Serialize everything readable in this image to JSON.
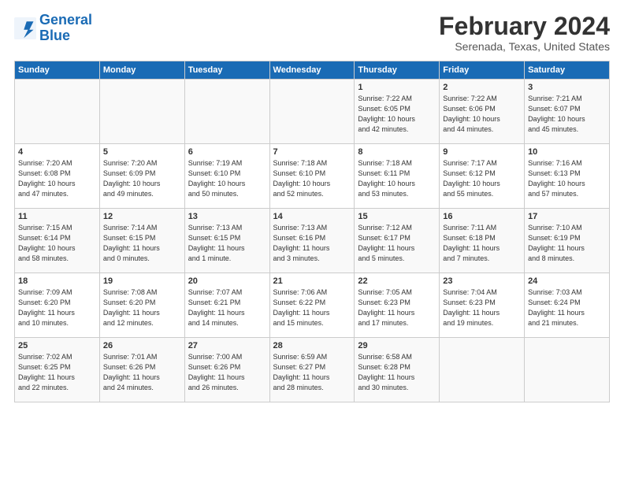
{
  "header": {
    "logo_line1": "General",
    "logo_line2": "Blue",
    "title": "February 2024",
    "subtitle": "Serenada, Texas, United States"
  },
  "weekdays": [
    "Sunday",
    "Monday",
    "Tuesday",
    "Wednesday",
    "Thursday",
    "Friday",
    "Saturday"
  ],
  "weeks": [
    [
      {
        "day": "",
        "info": ""
      },
      {
        "day": "",
        "info": ""
      },
      {
        "day": "",
        "info": ""
      },
      {
        "day": "",
        "info": ""
      },
      {
        "day": "1",
        "info": "Sunrise: 7:22 AM\nSunset: 6:05 PM\nDaylight: 10 hours\nand 42 minutes."
      },
      {
        "day": "2",
        "info": "Sunrise: 7:22 AM\nSunset: 6:06 PM\nDaylight: 10 hours\nand 44 minutes."
      },
      {
        "day": "3",
        "info": "Sunrise: 7:21 AM\nSunset: 6:07 PM\nDaylight: 10 hours\nand 45 minutes."
      }
    ],
    [
      {
        "day": "4",
        "info": "Sunrise: 7:20 AM\nSunset: 6:08 PM\nDaylight: 10 hours\nand 47 minutes."
      },
      {
        "day": "5",
        "info": "Sunrise: 7:20 AM\nSunset: 6:09 PM\nDaylight: 10 hours\nand 49 minutes."
      },
      {
        "day": "6",
        "info": "Sunrise: 7:19 AM\nSunset: 6:10 PM\nDaylight: 10 hours\nand 50 minutes."
      },
      {
        "day": "7",
        "info": "Sunrise: 7:18 AM\nSunset: 6:10 PM\nDaylight: 10 hours\nand 52 minutes."
      },
      {
        "day": "8",
        "info": "Sunrise: 7:18 AM\nSunset: 6:11 PM\nDaylight: 10 hours\nand 53 minutes."
      },
      {
        "day": "9",
        "info": "Sunrise: 7:17 AM\nSunset: 6:12 PM\nDaylight: 10 hours\nand 55 minutes."
      },
      {
        "day": "10",
        "info": "Sunrise: 7:16 AM\nSunset: 6:13 PM\nDaylight: 10 hours\nand 57 minutes."
      }
    ],
    [
      {
        "day": "11",
        "info": "Sunrise: 7:15 AM\nSunset: 6:14 PM\nDaylight: 10 hours\nand 58 minutes."
      },
      {
        "day": "12",
        "info": "Sunrise: 7:14 AM\nSunset: 6:15 PM\nDaylight: 11 hours\nand 0 minutes."
      },
      {
        "day": "13",
        "info": "Sunrise: 7:13 AM\nSunset: 6:15 PM\nDaylight: 11 hours\nand 1 minute."
      },
      {
        "day": "14",
        "info": "Sunrise: 7:13 AM\nSunset: 6:16 PM\nDaylight: 11 hours\nand 3 minutes."
      },
      {
        "day": "15",
        "info": "Sunrise: 7:12 AM\nSunset: 6:17 PM\nDaylight: 11 hours\nand 5 minutes."
      },
      {
        "day": "16",
        "info": "Sunrise: 7:11 AM\nSunset: 6:18 PM\nDaylight: 11 hours\nand 7 minutes."
      },
      {
        "day": "17",
        "info": "Sunrise: 7:10 AM\nSunset: 6:19 PM\nDaylight: 11 hours\nand 8 minutes."
      }
    ],
    [
      {
        "day": "18",
        "info": "Sunrise: 7:09 AM\nSunset: 6:20 PM\nDaylight: 11 hours\nand 10 minutes."
      },
      {
        "day": "19",
        "info": "Sunrise: 7:08 AM\nSunset: 6:20 PM\nDaylight: 11 hours\nand 12 minutes."
      },
      {
        "day": "20",
        "info": "Sunrise: 7:07 AM\nSunset: 6:21 PM\nDaylight: 11 hours\nand 14 minutes."
      },
      {
        "day": "21",
        "info": "Sunrise: 7:06 AM\nSunset: 6:22 PM\nDaylight: 11 hours\nand 15 minutes."
      },
      {
        "day": "22",
        "info": "Sunrise: 7:05 AM\nSunset: 6:23 PM\nDaylight: 11 hours\nand 17 minutes."
      },
      {
        "day": "23",
        "info": "Sunrise: 7:04 AM\nSunset: 6:23 PM\nDaylight: 11 hours\nand 19 minutes."
      },
      {
        "day": "24",
        "info": "Sunrise: 7:03 AM\nSunset: 6:24 PM\nDaylight: 11 hours\nand 21 minutes."
      }
    ],
    [
      {
        "day": "25",
        "info": "Sunrise: 7:02 AM\nSunset: 6:25 PM\nDaylight: 11 hours\nand 22 minutes."
      },
      {
        "day": "26",
        "info": "Sunrise: 7:01 AM\nSunset: 6:26 PM\nDaylight: 11 hours\nand 24 minutes."
      },
      {
        "day": "27",
        "info": "Sunrise: 7:00 AM\nSunset: 6:26 PM\nDaylight: 11 hours\nand 26 minutes."
      },
      {
        "day": "28",
        "info": "Sunrise: 6:59 AM\nSunset: 6:27 PM\nDaylight: 11 hours\nand 28 minutes."
      },
      {
        "day": "29",
        "info": "Sunrise: 6:58 AM\nSunset: 6:28 PM\nDaylight: 11 hours\nand 30 minutes."
      },
      {
        "day": "",
        "info": ""
      },
      {
        "day": "",
        "info": ""
      }
    ]
  ]
}
